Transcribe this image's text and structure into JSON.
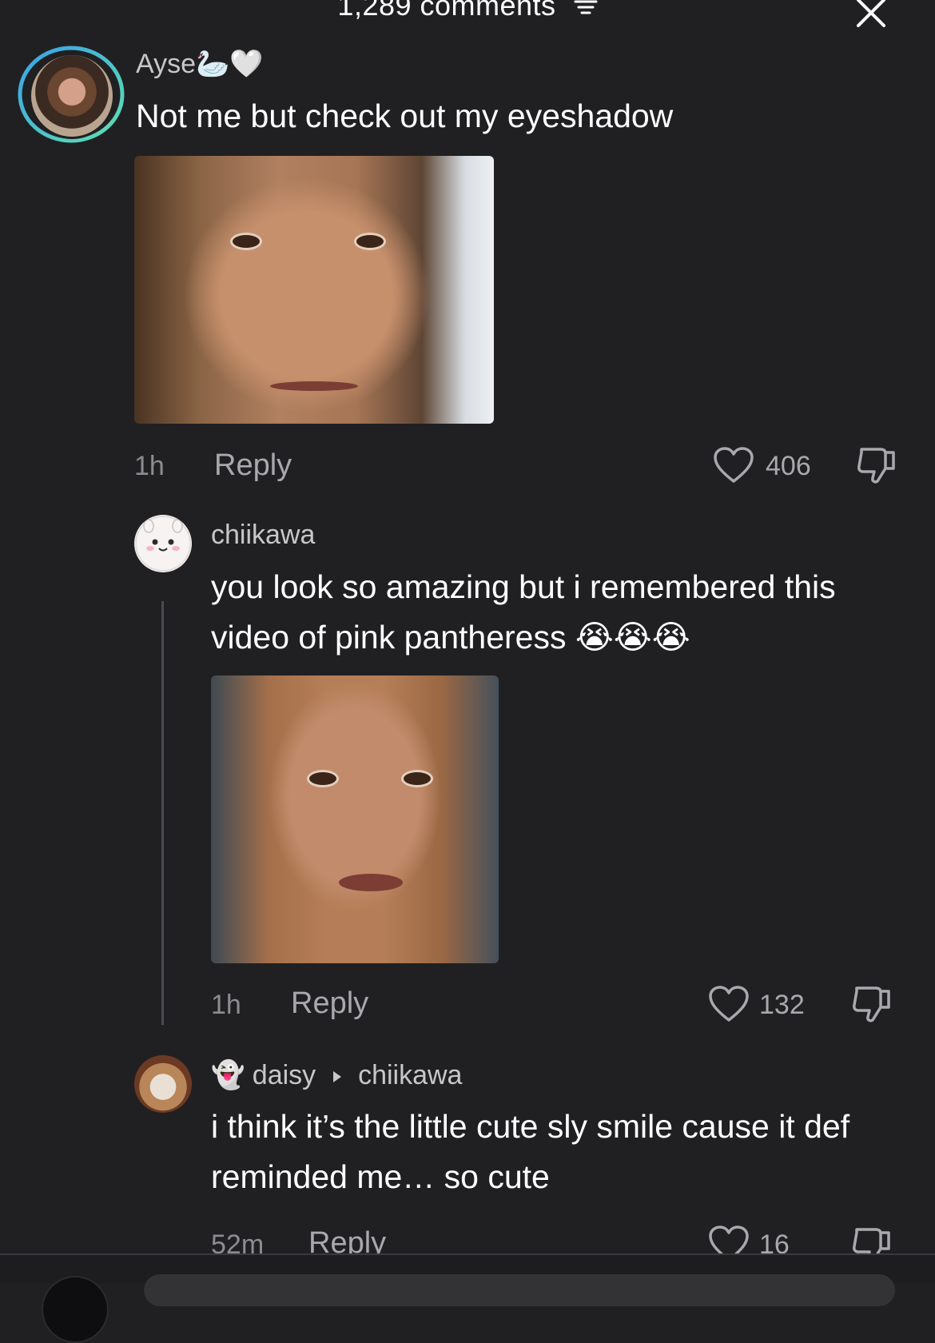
{
  "header": {
    "comments_count": "1,289 comments",
    "filter_icon": "filter-icon",
    "close_icon": "close-icon"
  },
  "comments": [
    {
      "username": "Ayse",
      "username_emoji": "🦢🤍",
      "text": "Not me but check out my eyeshadow",
      "time": "1h",
      "reply_label": "Reply",
      "likes": "406"
    },
    {
      "username": "chiikawa",
      "text": "you look so amazing but i remembered this video of pink pantheress",
      "emoji": "😭😭😭",
      "time": "1h",
      "reply_label": "Reply",
      "likes": "132"
    },
    {
      "username_prefix_emoji": "👻",
      "username": "daisy",
      "reply_to": "chiikawa",
      "text": "i think it’s the little cute sly smile cause it def reminded me… so cute",
      "time": "52m",
      "reply_label": "Reply",
      "likes": "16"
    }
  ],
  "colors": {
    "background": "#202022",
    "text_primary": "#ffffff",
    "text_secondary": "#a9a9ad",
    "avatar_ring_start": "#3aa0e8",
    "avatar_ring_end": "#5fe0b0"
  }
}
